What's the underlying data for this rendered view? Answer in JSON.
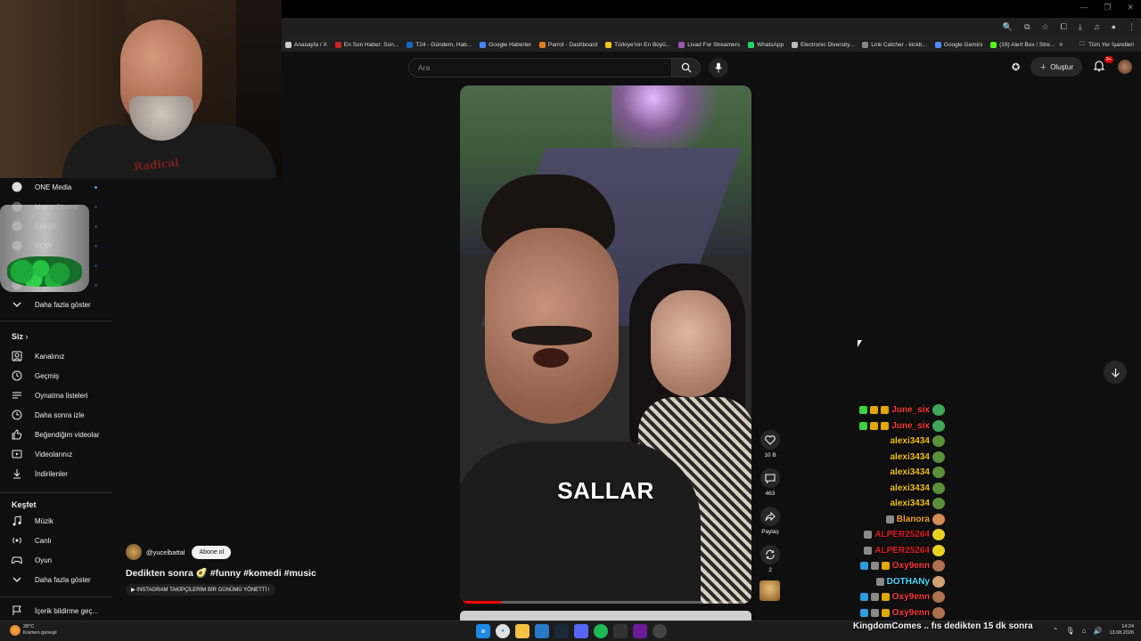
{
  "browser": {
    "bookmarks": [
      {
        "label": "Anasayfa / X",
        "color": "#cccccc"
      },
      {
        "label": "En Son Haber: Son...",
        "color": "#c62828"
      },
      {
        "label": "T24 - Gündem, Hab...",
        "color": "#1565c0"
      },
      {
        "label": "Google Haberler",
        "color": "#4285f4"
      },
      {
        "label": "Parrot - Dashboard",
        "color": "#e67e22"
      },
      {
        "label": "Türkiye'nin En Büyü...",
        "color": "#f0c419"
      },
      {
        "label": "Livad For Streamers",
        "color": "#9b59b6"
      },
      {
        "label": "WhatsApp",
        "color": "#25d366"
      },
      {
        "label": "Electronic Diversity...",
        "color": "#bbbbbb"
      },
      {
        "label": "Link Catcher - kickb...",
        "color": "#888888"
      },
      {
        "label": "Google Gemini",
        "color": "#4f8bf7"
      },
      {
        "label": "(19) Alert Box / Stre...",
        "color": "#53fc18"
      }
    ],
    "all_bookmarks": "Tüm Yer İşaretleri"
  },
  "header": {
    "search_placeholder": "Ara",
    "create_label": "Oluştur",
    "notif_count": "9+"
  },
  "sidebar": {
    "top_items": [
      {
        "label": "ONE Media",
        "icon": "channel-avatar-icon",
        "dot": true
      },
      {
        "label": "Mama Drama",
        "icon": "channel-avatar-icon",
        "dot": true
      },
      {
        "label": "ERLIN",
        "icon": "channel-avatar-icon",
        "dot": true
      },
      {
        "label": "ROW",
        "icon": "channel-avatar-icon",
        "dot": true
      },
      {
        "label": "",
        "icon": "channel-avatar-icon",
        "dot": true
      },
      {
        "label": "",
        "icon": "channel-avatar-icon",
        "dot": true
      }
    ],
    "show_more": "Daha fazla göster",
    "you_section": "Siz",
    "you_items": [
      {
        "label": "Kanalınız",
        "icon": "channel-icon"
      },
      {
        "label": "Geçmiş",
        "icon": "history-icon"
      },
      {
        "label": "Oynatma listeleri",
        "icon": "playlist-icon"
      },
      {
        "label": "Daha sonra izle",
        "icon": "clock-icon"
      },
      {
        "label": "Beğendiğim videolar",
        "icon": "thumbs-up-icon"
      },
      {
        "label": "Videolarınız",
        "icon": "video-icon"
      },
      {
        "label": "İndirilenler",
        "icon": "download-icon"
      }
    ],
    "explore_section": "Keşfet",
    "explore_items": [
      {
        "label": "Müzik",
        "icon": "music-icon"
      },
      {
        "label": "Canlı",
        "icon": "live-icon"
      },
      {
        "label": "Oyun",
        "icon": "gaming-icon"
      },
      {
        "label": "Daha fazla göster",
        "icon": "chevron-down-icon"
      }
    ],
    "report_label": "İçerik bildirme geç..."
  },
  "video": {
    "caption": "SALLAR",
    "progress": 0.14,
    "channel": "@yucelbattal",
    "subscribe": "Abone ol",
    "title": "Dedikten sonra 🥑 #funny #komedi #music",
    "subtitle": "▶ INSTAGRAM TAKİPÇİLERİM BİR GÜNÜMÜ YÖNETTİ !"
  },
  "actions": {
    "likes": "10 B",
    "comments": "463",
    "share": "Paylaş",
    "remix": "2"
  },
  "chat": [
    {
      "name": "June_six",
      "color": "#ff3b3b",
      "badges": [
        "#3dd13d",
        "#e0a800",
        "#e0a800"
      ],
      "emote": "#3fa65a"
    },
    {
      "name": "June_six",
      "color": "#ff3b3b",
      "badges": [
        "#3dd13d",
        "#e0a800",
        "#e0a800"
      ],
      "emote": "#3fa65a"
    },
    {
      "name": "alexi3434",
      "color": "#f5c400",
      "badges": [],
      "emote": "#5a8f3c"
    },
    {
      "name": "alexi3434",
      "color": "#f5c400",
      "badges": [],
      "emote": "#5a8f3c"
    },
    {
      "name": "alexi3434",
      "color": "#f5c400",
      "badges": [],
      "emote": "#5a8f3c"
    },
    {
      "name": "alexi3434",
      "color": "#f5c400",
      "badges": [],
      "emote": "#5a8f3c"
    },
    {
      "name": "alexi3434",
      "color": "#f5c400",
      "badges": [],
      "emote": "#5a8f3c"
    },
    {
      "name": "Blanora",
      "color": "#f5a623",
      "badges": [
        "#8a8a8a"
      ],
      "emote": "#d58a5a"
    },
    {
      "name": "ALPER25264",
      "color": "#e02020",
      "badges": [
        "#8a8a8a"
      ],
      "emote": "#e8d020"
    },
    {
      "name": "ALPER25264",
      "color": "#e02020",
      "badges": [
        "#8a8a8a"
      ],
      "emote": "#e8d020"
    },
    {
      "name": "Oxy9enn",
      "color": "#ff3b3b",
      "badges": [
        "#2c9be0",
        "#8a8a8a",
        "#e0a800"
      ],
      "emote": "#b07050"
    },
    {
      "name": "DOTHANy",
      "color": "#40e0ff",
      "badges": [
        "#8a8a8a"
      ],
      "emote": "#d0a070"
    },
    {
      "name": "Oxy9enn",
      "color": "#ff3b3b",
      "badges": [
        "#2c9be0",
        "#8a8a8a",
        "#e0a800"
      ],
      "emote": "#b07050"
    },
    {
      "name": "Oxy9enn",
      "color": "#ff3b3b",
      "badges": [
        "#2c9be0",
        "#8a8a8a",
        "#e0a800"
      ],
      "emote": "#b07050"
    }
  ],
  "ticker": "KingdomComes  .. fıs dedikten 15 dk sonra",
  "taskbar": {
    "weather_temp": "28°C",
    "weather_desc": "Kısmen güneşli",
    "time": "14:24",
    "date": "13.08.2026"
  }
}
